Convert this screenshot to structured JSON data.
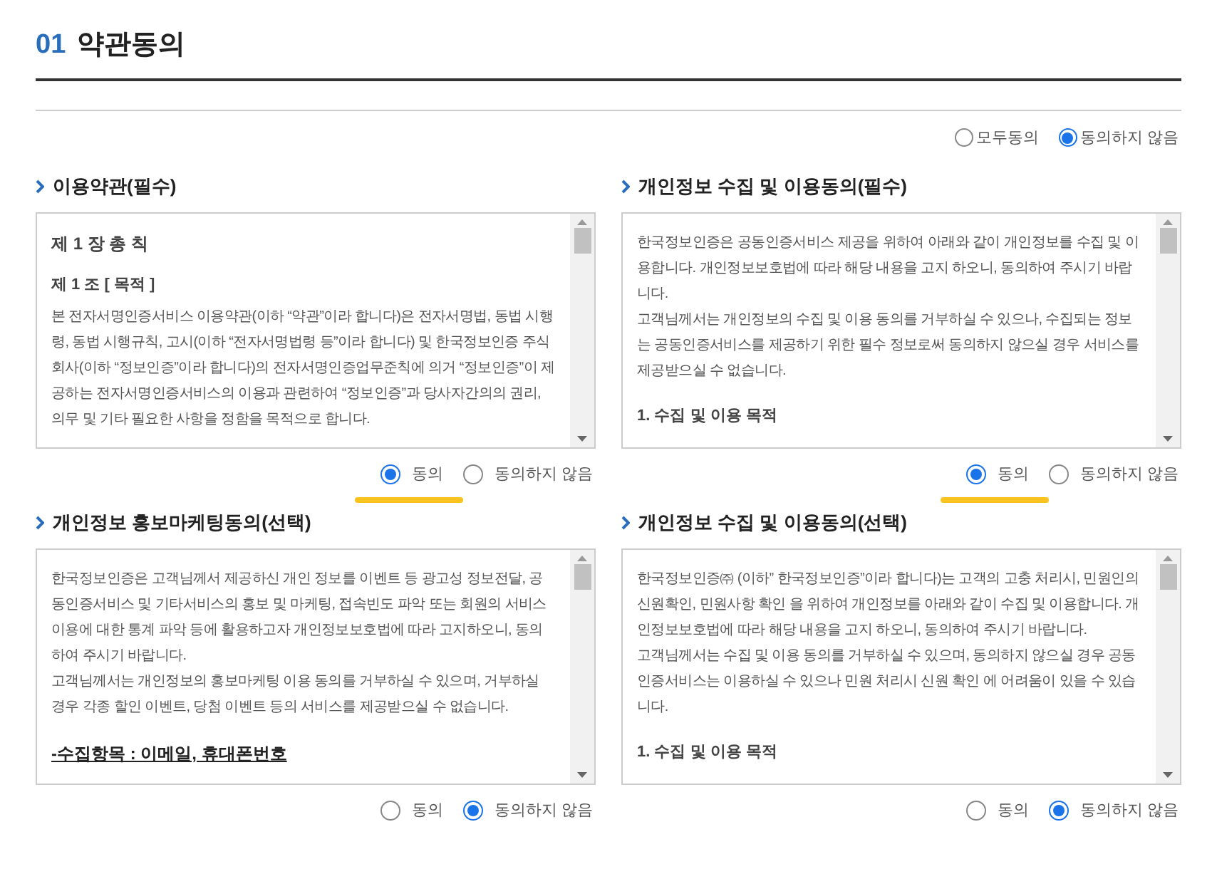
{
  "title": {
    "number": "01",
    "text": "약관동의"
  },
  "all_agree": [
    {
      "label": "모두동의",
      "selected": false
    },
    {
      "label": "동의하지 않음",
      "selected": true
    }
  ],
  "sections": [
    {
      "title": "이용약관(필수)",
      "highlighted": true,
      "content": [
        {
          "kind": "heading",
          "text": "제 1 장 총 칙"
        },
        {
          "kind": "subheading",
          "text": "제 1 조 [ 목적 ]"
        },
        {
          "kind": "paragraph",
          "text": "본 전자서명인증서비스 이용약관(이하 “약관”이라 합니다)은 전자서명법, 동법 시행령, 동법 시행규칙, 고시(이하 “전자서명법령 등”이라 합니다) 및 한국정보인증 주식회사(이하 “정보인증”이라 합니다)의 전자서명인증업무준칙에 의거 “정보인증”이 제공하는 전자서명인증서비스의 이용과 관련하여 “정보인증”과 당사자간의의 권리, 의무 및 기타 필요한 사항을 정함을 목적으로 합니다."
        }
      ],
      "options": [
        {
          "label": "동의",
          "selected": true
        },
        {
          "label": "동의하지 않음",
          "selected": false
        }
      ]
    },
    {
      "title": "개인정보 수집 및 이용동의(필수)",
      "highlighted": true,
      "content": [
        {
          "kind": "paragraph",
          "text": "한국정보인증은 공동인증서비스 제공을 위하여 아래와 같이 개인정보를 수집 및 이용합니다. 개인정보보호법에 따라 해당 내용을 고지 하오니, 동의하여 주시기 바랍니다."
        },
        {
          "kind": "paragraph",
          "text": "고객님께서는 개인정보의 수집 및 이용 동의를 거부하실 수 있으나, 수집되는 정보는 공동인증서비스를 제공하기 위한 필수 정보로써 동의하지 않으실 경우 서비스를 제공받으실 수 없습니다."
        },
        {
          "kind": "item",
          "text": "1. 수집 및 이용 목적"
        }
      ],
      "options": [
        {
          "label": "동의",
          "selected": true
        },
        {
          "label": "동의하지 않음",
          "selected": false
        }
      ]
    },
    {
      "title": "개인정보 홍보마케팅동의(선택)",
      "highlighted": false,
      "content": [
        {
          "kind": "paragraph",
          "text": "한국정보인증은 고객님께서 제공하신 개인 정보를 이벤트 등 광고성 정보전달, 공동인증서비스 및 기타서비스의 홍보 및 마케팅, 접속빈도 파악 또는 회원의 서비스 이용에 대한 통계 파악 등에 활용하고자 개인정보보호법에 따라 고지하오니, 동의하여 주시기 바랍니다."
        },
        {
          "kind": "paragraph",
          "text": "고객님께서는 개인정보의 홍보마케팅 이용 동의를 거부하실 수 있으며, 거부하실 경우 각종 할인 이벤트, 당첨 이벤트 등의 서비스를 제공받으실 수 없습니다."
        },
        {
          "kind": "underlined",
          "text": "-수집항목 : 이메일, 휴대폰번호"
        }
      ],
      "options": [
        {
          "label": "동의",
          "selected": false
        },
        {
          "label": "동의하지 않음",
          "selected": true
        }
      ]
    },
    {
      "title": "개인정보 수집 및 이용동의(선택)",
      "highlighted": false,
      "content": [
        {
          "kind": "paragraph",
          "text": "한국정보인증㈜ (이하” 한국정보인증”이라 합니다)는 고객의 고충 처리시, 민원인의 신원확인, 민원사항 확인 을 위하여 개인정보를 아래와 같이 수집 및 이용합니다. 개인정보보호법에 따라 해당 내용을 고지 하오니, 동의하여 주시기 바랍니다."
        },
        {
          "kind": "paragraph",
          "text": "고객님께서는 수집 및 이용 동의를 거부하실 수 있으며, 동의하지 않으실 경우 공동인증서비스는 이용하실 수 있으나 민원 처리시 신원 확인 에 어려움이 있을 수 있습니다."
        },
        {
          "kind": "item",
          "text": "1. 수집 및 이용 목적"
        }
      ],
      "options": [
        {
          "label": "동의",
          "selected": false
        },
        {
          "label": "동의하지 않음",
          "selected": true
        }
      ]
    }
  ]
}
